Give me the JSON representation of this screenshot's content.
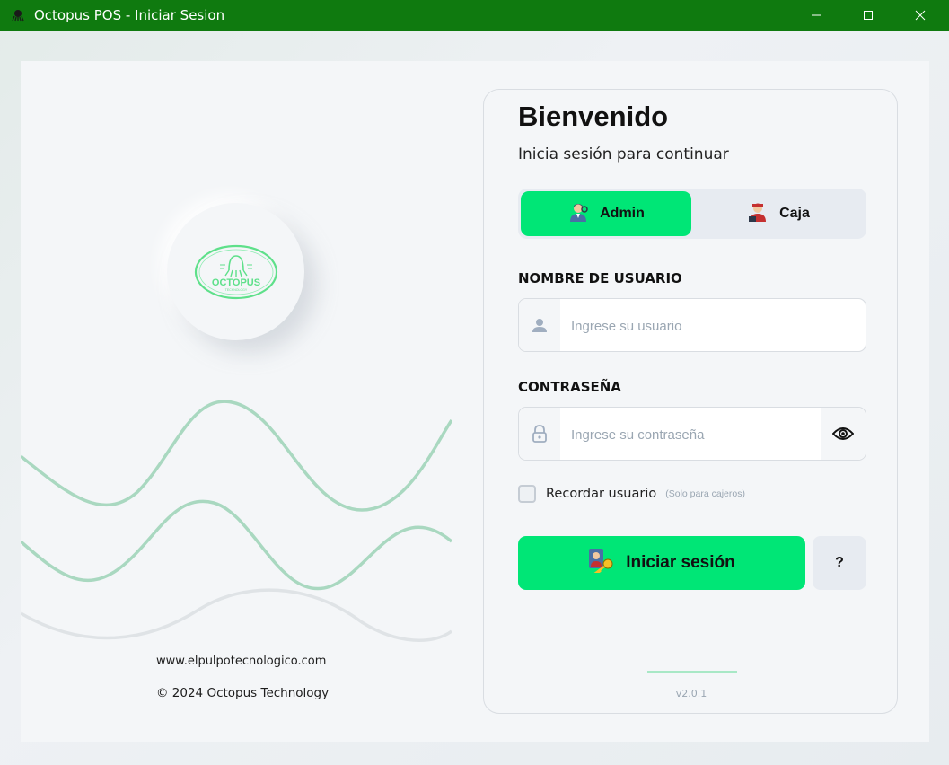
{
  "window": {
    "title": "Octopus POS - Iniciar Sesion",
    "accent": "#0f7a0f"
  },
  "brand": {
    "logo_text": "OCTOPUS",
    "logo_subtext": "TECHNOLOGY",
    "website": "www.elpulpotecnologico.com",
    "copyright": "© 2024 Octopus Technology"
  },
  "login": {
    "title": "Bienvenido",
    "subtitle": "Inicia sesión para continuar",
    "roles": [
      {
        "label": "Admin",
        "icon": "admin-avatar-icon",
        "selected": true
      },
      {
        "label": "Caja",
        "icon": "cashier-avatar-icon",
        "selected": false
      }
    ],
    "username": {
      "label": "NOMBRE DE USUARIO",
      "placeholder": "Ingrese su usuario",
      "value": "",
      "icon": "user-icon"
    },
    "password": {
      "label": "CONTRASEÑA",
      "placeholder": "Ingrese su contraseña",
      "value": "",
      "icon": "lock-icon",
      "toggle_icon": "eye-icon"
    },
    "remember": {
      "label": "Recordar usuario",
      "note": "(Solo para cajeros)",
      "checked": false
    },
    "submit_label": "Iniciar sesión",
    "help_label": "?",
    "version": "v2.0.1",
    "primary_color": "#00e676"
  }
}
